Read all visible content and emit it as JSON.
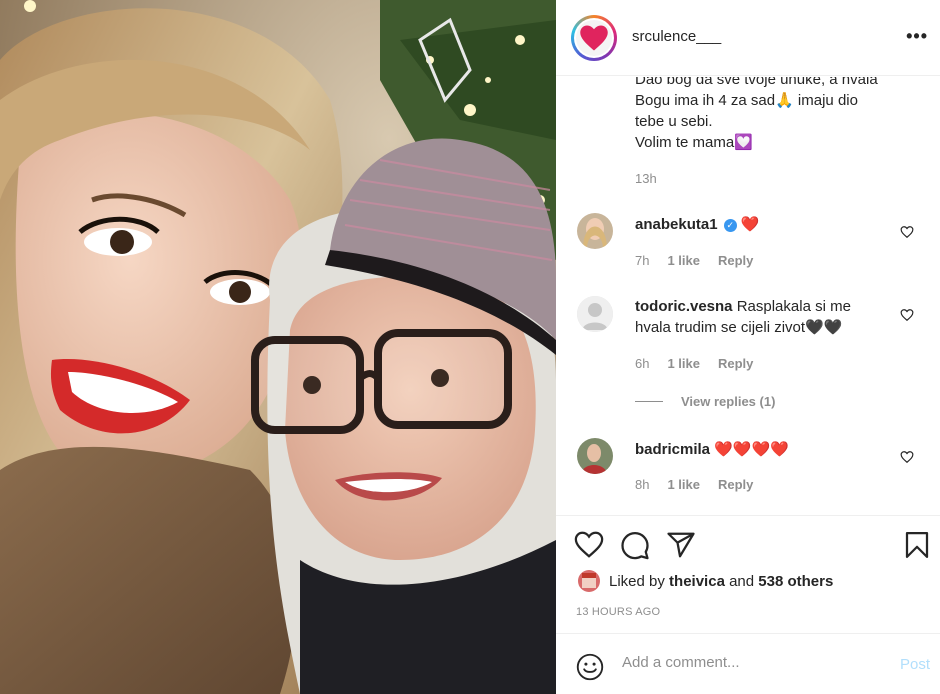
{
  "post": {
    "username": "srculence___",
    "more_label": "•••"
  },
  "caption": {
    "line1": "Dao bog da sve tvoje unuke, a hvala",
    "line2": "Bogu ima ih 4 za sad🙏 imaju dio",
    "line3": "tebe u sebi.",
    "line4": "Volim te mama💟",
    "time": "13h"
  },
  "comments": [
    {
      "user": "anabekuta1",
      "text": "❤️",
      "verified": true,
      "time": "7h",
      "likes": "1 like",
      "reply": "Reply"
    },
    {
      "user": "todoric.vesna",
      "text": "Rasplakala si me",
      "text2": "hvala trudim se cijeli zivot🖤🖤",
      "time": "6h",
      "likes": "1 like",
      "reply": "Reply"
    },
    {
      "user": "badricmila",
      "text": "❤️❤️❤️❤️",
      "time": "8h",
      "likes": "1 like",
      "reply": "Reply"
    }
  ],
  "view_replies": "View replies (1)",
  "likes": {
    "prefix": "Liked by",
    "user": "theivica",
    "and": "and",
    "others": "538 others"
  },
  "timestamp": "13 HOURS AGO",
  "add_comment": {
    "placeholder": "Add a comment...",
    "post_label": "Post"
  },
  "colors": {
    "heart": "#ed4956",
    "post_disabled": "#b2dffc",
    "verified": "#3897f0"
  }
}
